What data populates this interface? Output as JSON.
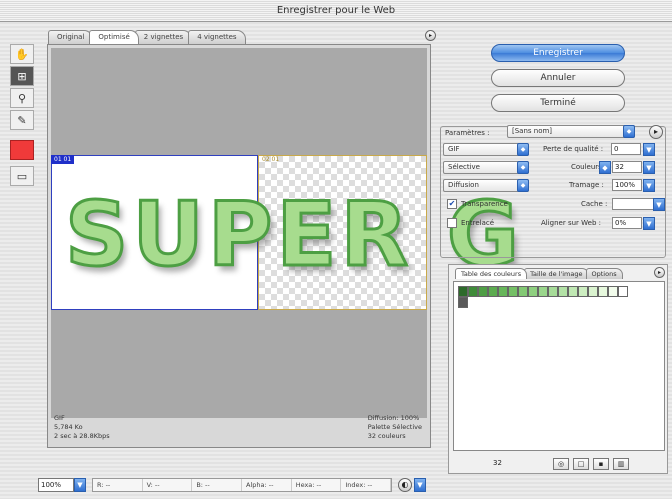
{
  "window": {
    "title": "Enregistrer pour le Web"
  },
  "preview_tabs": [
    {
      "label": "Original"
    },
    {
      "label": "Optimisé"
    },
    {
      "label": "2 vignettes"
    },
    {
      "label": "4 vignettes"
    }
  ],
  "actions": {
    "save_label": "Enregistrer",
    "cancel_label": "Annuler",
    "done_label": "Terminé"
  },
  "tools": [
    "hand-icon",
    "slice-select-icon",
    "zoom-icon",
    "eyedropper-icon",
    "color-swatch-icon",
    "toggle-slices-icon"
  ],
  "preview": {
    "slice1_label": "01 01",
    "slice2_label": "02 01",
    "image_text": "SUPER G",
    "info_left": [
      "GIF",
      "5,784 Ko",
      "2 sec à 28.8Kbps"
    ],
    "info_right": [
      "Diffusion: 100%",
      "Palette Sélective",
      "32 couleurs"
    ]
  },
  "settings": {
    "label": "Paramètres :",
    "preset_value": "[Sans nom]",
    "format_value": "GIF",
    "palette_value": "Sélective",
    "dither_value": "Diffusion",
    "lossy_label": "Perte de qualité :",
    "lossy_value": "0",
    "colors_label": "Couleurs :",
    "colors_value": "32",
    "dither_amount_label": "Tramage :",
    "dither_amount_value": "100%",
    "transparency_label": "Transparence",
    "transparency_checked": "✔",
    "matte_label": "Cache :",
    "interlaced_label": "Entrelacé",
    "websnap_label": "Aligner sur Web :",
    "websnap_value": "0%"
  },
  "color_panel": {
    "tabs": [
      "Table des couleurs",
      "Taille de l'image",
      "Options"
    ],
    "count": "32",
    "swatches": [
      "#2d6a2a",
      "#3f8b39",
      "#4f9e45",
      "#5cab4f",
      "#67b65a",
      "#75c066",
      "#83c974",
      "#8fd080",
      "#9ad68c",
      "#a7dc99",
      "#b3e2a6",
      "#c0e8b3",
      "#cdeec1",
      "#daf3cf",
      "#e6f8dd",
      "#f2fcec",
      "#ffffff",
      "#5a5a5a"
    ]
  },
  "bottom": {
    "zoom_value": "100%",
    "pixel_fields": [
      "R: --",
      "V: --",
      "B: --",
      "Alpha: --",
      "Hexa: --",
      "Index: --"
    ]
  }
}
